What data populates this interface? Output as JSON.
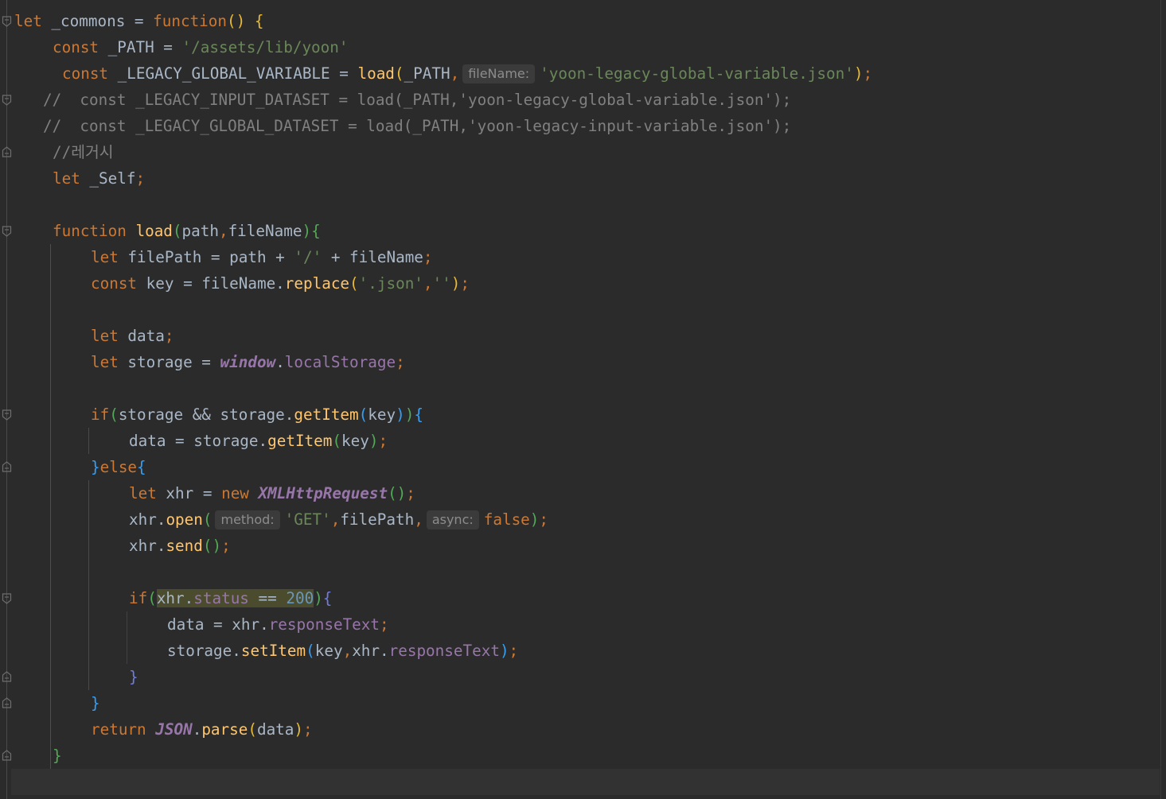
{
  "lines": [
    {
      "tokens": [
        {
          "t": "let",
          "c": "kw"
        },
        {
          "t": " _commons = ",
          "c": ""
        },
        {
          "t": "function",
          "c": "kw"
        },
        {
          "t": "()",
          "c": "p1"
        },
        {
          "t": " ",
          "c": ""
        },
        {
          "t": "{",
          "c": "p1"
        }
      ]
    },
    {
      "tokens": [
        {
          "t": "const",
          "c": "kw"
        },
        {
          "t": " _PATH = ",
          "c": ""
        },
        {
          "t": "'/assets/lib/yoon'",
          "c": "str"
        }
      ]
    },
    {
      "tokens": [
        {
          "t": "const",
          "c": "kw"
        },
        {
          "t": " _LEGACY_GLOBAL_VARIABLE = ",
          "c": ""
        },
        {
          "t": "load",
          "c": "fn"
        },
        {
          "t": "(",
          "c": "p1"
        },
        {
          "t": "_PATH",
          "c": ""
        },
        {
          "t": ",",
          "c": "kw"
        },
        {
          "t": "fileName:",
          "c": "hint"
        },
        {
          "t": "'yoon-legacy-global-variable.json'",
          "c": "str"
        },
        {
          "t": ")",
          "c": "p1"
        },
        {
          "t": ";",
          "c": "kw"
        }
      ]
    },
    {
      "tokens": [
        {
          "t": "//  const _LEGACY_INPUT_DATASET = load(_PATH,'yoon-legacy-global-variable.json');",
          "c": "cmt"
        }
      ]
    },
    {
      "tokens": [
        {
          "t": "//  const _LEGACY_GLOBAL_DATASET = load(_PATH,'yoon-legacy-input-variable.json');",
          "c": "cmt"
        }
      ]
    },
    {
      "tokens": [
        {
          "t": "//레거시",
          "c": "cmt"
        }
      ]
    },
    {
      "tokens": [
        {
          "t": "let",
          "c": "kw"
        },
        {
          "t": " _Self",
          "c": ""
        },
        {
          "t": ";",
          "c": "kw"
        }
      ]
    },
    {
      "tokens": []
    },
    {
      "tokens": [
        {
          "t": "function",
          "c": "kw"
        },
        {
          "t": " ",
          "c": ""
        },
        {
          "t": "load",
          "c": "fn"
        },
        {
          "t": "(",
          "c": "p2"
        },
        {
          "t": "path",
          "c": ""
        },
        {
          "t": ",",
          "c": "kw"
        },
        {
          "t": "fileName",
          "c": ""
        },
        {
          "t": ")",
          "c": "p2"
        },
        {
          "t": "{",
          "c": "p2"
        }
      ]
    },
    {
      "tokens": [
        {
          "t": "let",
          "c": "kw"
        },
        {
          "t": " filePath = path + ",
          "c": ""
        },
        {
          "t": "'/'",
          "c": "str"
        },
        {
          "t": " + fileName",
          "c": ""
        },
        {
          "t": ";",
          "c": "kw"
        }
      ]
    },
    {
      "tokens": [
        {
          "t": "const",
          "c": "kw"
        },
        {
          "t": " key = fileName.",
          "c": ""
        },
        {
          "t": "replace",
          "c": "fn"
        },
        {
          "t": "(",
          "c": "p1"
        },
        {
          "t": "'.json'",
          "c": "str"
        },
        {
          "t": ",",
          "c": "kw"
        },
        {
          "t": "''",
          "c": "str"
        },
        {
          "t": ")",
          "c": "p1"
        },
        {
          "t": ";",
          "c": "kw"
        }
      ]
    },
    {
      "tokens": []
    },
    {
      "tokens": [
        {
          "t": "let",
          "c": "kw"
        },
        {
          "t": " data",
          "c": ""
        },
        {
          "t": ";",
          "c": "kw"
        }
      ]
    },
    {
      "tokens": [
        {
          "t": "let",
          "c": "kw"
        },
        {
          "t": " storage = ",
          "c": ""
        },
        {
          "t": "window",
          "c": "glob"
        },
        {
          "t": ".",
          "c": ""
        },
        {
          "t": "localStorage",
          "c": "prop"
        },
        {
          "t": ";",
          "c": "kw"
        }
      ]
    },
    {
      "tokens": []
    },
    {
      "tokens": [
        {
          "t": "if",
          "c": "kw"
        },
        {
          "t": "(",
          "c": "p2"
        },
        {
          "t": "storage && storage.",
          "c": ""
        },
        {
          "t": "getItem",
          "c": "fn"
        },
        {
          "t": "(",
          "c": "p3"
        },
        {
          "t": "key",
          "c": ""
        },
        {
          "t": ")",
          "c": "p3"
        },
        {
          "t": ")",
          "c": "p2"
        },
        {
          "t": "{",
          "c": "p3"
        }
      ]
    },
    {
      "tokens": [
        {
          "t": "data = storage.",
          "c": ""
        },
        {
          "t": "getItem",
          "c": "fn"
        },
        {
          "t": "(",
          "c": "p2"
        },
        {
          "t": "key",
          "c": ""
        },
        {
          "t": ")",
          "c": "p2"
        },
        {
          "t": ";",
          "c": "kw"
        }
      ]
    },
    {
      "tokens": [
        {
          "t": "}",
          "c": "p3"
        },
        {
          "t": "else",
          "c": "kw"
        },
        {
          "t": "{",
          "c": "p3"
        }
      ]
    },
    {
      "tokens": [
        {
          "t": "let",
          "c": "kw"
        },
        {
          "t": " xhr = ",
          "c": ""
        },
        {
          "t": "new",
          "c": "kw"
        },
        {
          "t": " ",
          "c": ""
        },
        {
          "t": "XMLHttpRequest",
          "c": "glob"
        },
        {
          "t": "()",
          "c": "p2"
        },
        {
          "t": ";",
          "c": "kw"
        }
      ]
    },
    {
      "tokens": [
        {
          "t": "xhr.",
          "c": ""
        },
        {
          "t": "open",
          "c": "fn"
        },
        {
          "t": "(",
          "c": "p2"
        },
        {
          "t": "method:",
          "c": "hint"
        },
        {
          "t": "'GET'",
          "c": "str"
        },
        {
          "t": ",",
          "c": "kw"
        },
        {
          "t": "filePath",
          "c": ""
        },
        {
          "t": ",",
          "c": "kw"
        },
        {
          "t": "async:",
          "c": "hint"
        },
        {
          "t": "false",
          "c": "kw"
        },
        {
          "t": ")",
          "c": "p2"
        },
        {
          "t": ";",
          "c": "kw"
        }
      ]
    },
    {
      "tokens": [
        {
          "t": "xhr.",
          "c": ""
        },
        {
          "t": "send",
          "c": "fn"
        },
        {
          "t": "()",
          "c": "p2"
        },
        {
          "t": ";",
          "c": "kw"
        }
      ]
    },
    {
      "tokens": []
    },
    {
      "tokens": [
        {
          "t": "if",
          "c": "kw"
        },
        {
          "t": "(",
          "c": "p2"
        },
        {
          "t": "xhr.",
          "c": "hl"
        },
        {
          "t": "status",
          "c": "prop hl"
        },
        {
          "t": " == ",
          "c": "hl"
        },
        {
          "t": "200",
          "c": "num hl"
        },
        {
          "t": ")",
          "c": "p2"
        },
        {
          "t": "{",
          "c": "p4"
        }
      ]
    },
    {
      "tokens": [
        {
          "t": "data = xhr.",
          "c": ""
        },
        {
          "t": "responseText",
          "c": "prop"
        },
        {
          "t": ";",
          "c": "kw"
        }
      ]
    },
    {
      "tokens": [
        {
          "t": "storage.",
          "c": ""
        },
        {
          "t": "setItem",
          "c": "fn"
        },
        {
          "t": "(",
          "c": "p3"
        },
        {
          "t": "key",
          "c": ""
        },
        {
          "t": ",",
          "c": "kw"
        },
        {
          "t": "xhr.",
          "c": ""
        },
        {
          "t": "responseText",
          "c": "prop"
        },
        {
          "t": ")",
          "c": "p3"
        },
        {
          "t": ";",
          "c": "kw"
        }
      ]
    },
    {
      "tokens": [
        {
          "t": "}",
          "c": "p4"
        }
      ]
    },
    {
      "tokens": [
        {
          "t": "}",
          "c": "p3"
        }
      ]
    },
    {
      "tokens": [
        {
          "t": "return",
          "c": "kw"
        },
        {
          "t": " ",
          "c": ""
        },
        {
          "t": "JSON",
          "c": "glob"
        },
        {
          "t": ".",
          "c": ""
        },
        {
          "t": "parse",
          "c": "fn"
        },
        {
          "t": "(",
          "c": "p1"
        },
        {
          "t": "data",
          "c": ""
        },
        {
          "t": ")",
          "c": "p1"
        },
        {
          "t": ";",
          "c": "kw"
        }
      ]
    },
    {
      "tokens": [
        {
          "t": "}",
          "c": "p2"
        }
      ]
    },
    {
      "tokens": []
    }
  ],
  "colors": {
    "background": "#2b2b2b",
    "keyword": "#cc7832",
    "function": "#ffc66d",
    "string": "#6a8759",
    "number": "#6897bb",
    "comment": "#808080",
    "property": "#9876aa",
    "text": "#a9b7c6"
  }
}
